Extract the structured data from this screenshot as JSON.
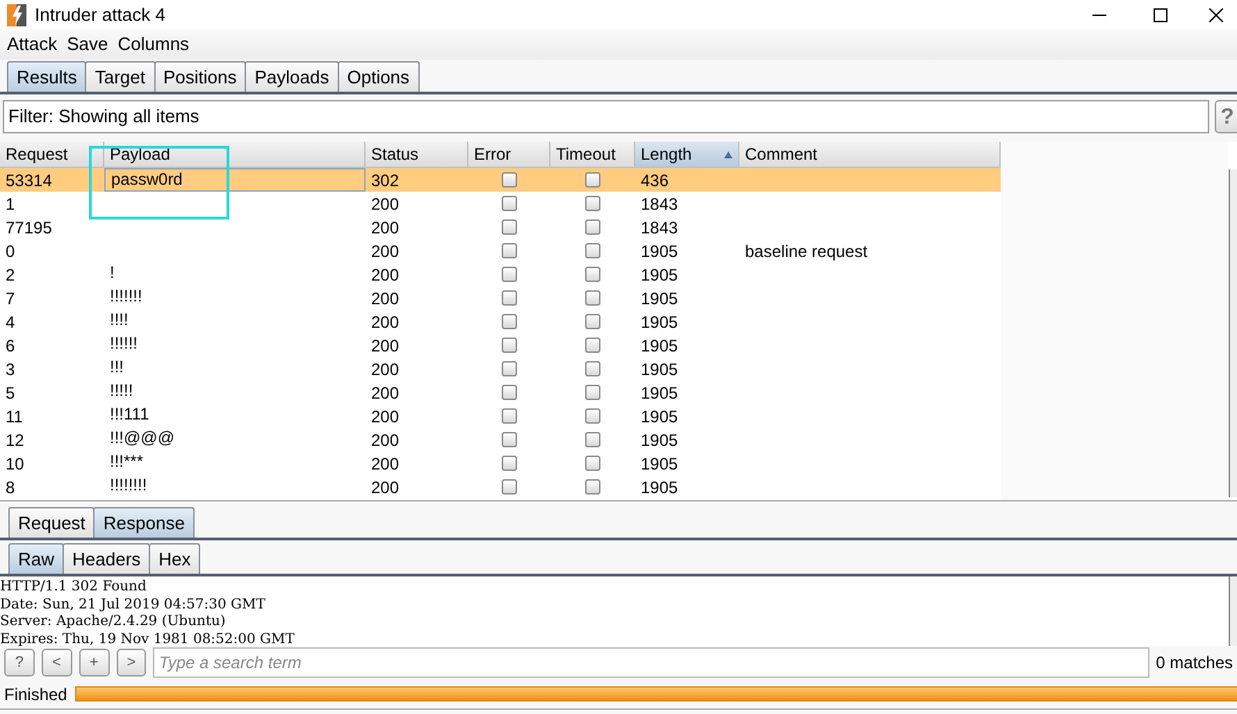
{
  "window": {
    "title": "Intruder attack 4"
  },
  "menu": [
    "Attack",
    "Save",
    "Columns"
  ],
  "tabs": [
    {
      "label": "Results",
      "selected": true
    },
    {
      "label": "Target",
      "selected": false
    },
    {
      "label": "Positions",
      "selected": false
    },
    {
      "label": "Payloads",
      "selected": false
    },
    {
      "label": "Options",
      "selected": false
    }
  ],
  "filter": {
    "text": "Filter: Showing all items",
    "help": "?"
  },
  "table": {
    "columns": [
      {
        "label": "Request",
        "sorted": false
      },
      {
        "label": "Payload",
        "sorted": false
      },
      {
        "label": "Status",
        "sorted": false
      },
      {
        "label": "Error",
        "sorted": false
      },
      {
        "label": "Timeout",
        "sorted": false
      },
      {
        "label": "Length",
        "sorted": true
      },
      {
        "label": "Comment",
        "sorted": false
      }
    ],
    "rows": [
      {
        "request": "53314",
        "payload": "passw0rd",
        "status": "302",
        "error": false,
        "timeout": false,
        "length": "436",
        "comment": "",
        "selected": true
      },
      {
        "request": "1",
        "payload": "",
        "status": "200",
        "error": false,
        "timeout": false,
        "length": "1843",
        "comment": "",
        "selected": false
      },
      {
        "request": "77195",
        "payload": "",
        "status": "200",
        "error": false,
        "timeout": false,
        "length": "1843",
        "comment": "",
        "selected": false
      },
      {
        "request": "0",
        "payload": "",
        "status": "200",
        "error": false,
        "timeout": false,
        "length": "1905",
        "comment": "baseline request",
        "selected": false
      },
      {
        "request": "2",
        "payload": "!",
        "status": "200",
        "error": false,
        "timeout": false,
        "length": "1905",
        "comment": "",
        "selected": false
      },
      {
        "request": "7",
        "payload": "!!!!!!!",
        "status": "200",
        "error": false,
        "timeout": false,
        "length": "1905",
        "comment": "",
        "selected": false
      },
      {
        "request": "4",
        "payload": "!!!!",
        "status": "200",
        "error": false,
        "timeout": false,
        "length": "1905",
        "comment": "",
        "selected": false
      },
      {
        "request": "6",
        "payload": "!!!!!!",
        "status": "200",
        "error": false,
        "timeout": false,
        "length": "1905",
        "comment": "",
        "selected": false
      },
      {
        "request": "3",
        "payload": "!!!",
        "status": "200",
        "error": false,
        "timeout": false,
        "length": "1905",
        "comment": "",
        "selected": false
      },
      {
        "request": "5",
        "payload": "!!!!!",
        "status": "200",
        "error": false,
        "timeout": false,
        "length": "1905",
        "comment": "",
        "selected": false
      },
      {
        "request": "11",
        "payload": "!!!111",
        "status": "200",
        "error": false,
        "timeout": false,
        "length": "1905",
        "comment": "",
        "selected": false
      },
      {
        "request": "12",
        "payload": "!!!@@@",
        "status": "200",
        "error": false,
        "timeout": false,
        "length": "1905",
        "comment": "",
        "selected": false
      },
      {
        "request": "10",
        "payload": "!!!***",
        "status": "200",
        "error": false,
        "timeout": false,
        "length": "1905",
        "comment": "",
        "selected": false
      },
      {
        "request": "8",
        "payload": "!!!!!!!!",
        "status": "200",
        "error": false,
        "timeout": false,
        "length": "1905",
        "comment": "",
        "selected": false
      }
    ]
  },
  "message_tabs": [
    {
      "label": "Request",
      "selected": false
    },
    {
      "label": "Response",
      "selected": true
    }
  ],
  "view_tabs": [
    {
      "label": "Raw",
      "selected": true
    },
    {
      "label": "Headers",
      "selected": false
    },
    {
      "label": "Hex",
      "selected": false
    }
  ],
  "response_lines": [
    "HTTP/1.1 302 Found",
    "Date: Sun, 21 Jul 2019 04:57:30 GMT",
    "Server: Apache/2.4.29 (Ubuntu)",
    "Expires: Thu, 19 Nov 1981 08:52:00 GMT"
  ],
  "search": {
    "buttons": [
      "?",
      "<",
      "+",
      ">"
    ],
    "placeholder": "Type a search term",
    "matches": "0 matches"
  },
  "status_bar": {
    "text": "Finished",
    "level": 1
  }
}
